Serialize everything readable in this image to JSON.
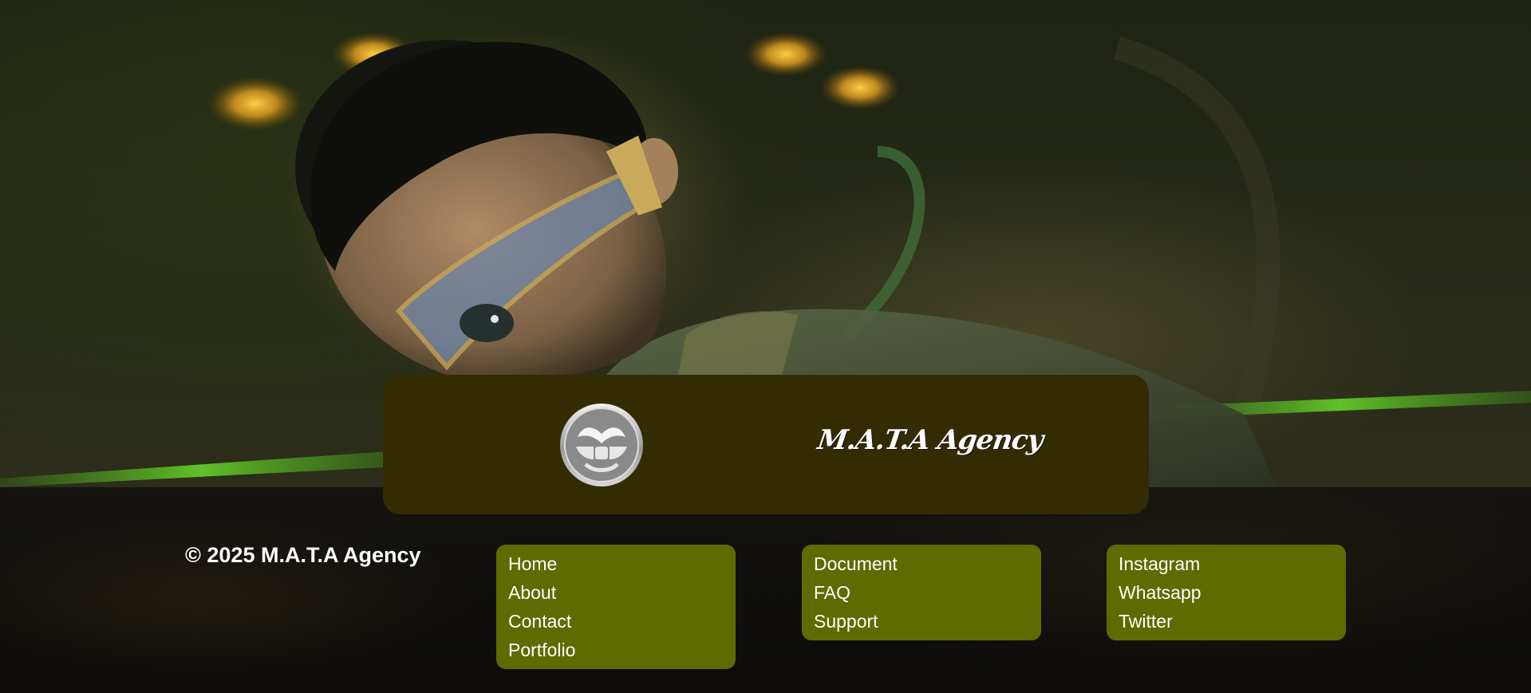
{
  "brand": {
    "name": "M.A.T.A Agency",
    "logo_icon": "mask-emblem-icon"
  },
  "footer": {
    "copyright": "© 2025 M.A.T.A Agency",
    "columns": [
      {
        "links": [
          "Home",
          "About",
          "Contact",
          "Portfolio"
        ]
      },
      {
        "links": [
          "Document",
          "FAQ",
          "Support"
        ]
      },
      {
        "links": [
          "Instagram",
          "Whatsapp",
          "Twitter"
        ]
      }
    ]
  },
  "colors": {
    "brand_card": "#332c03",
    "link_box": "#5e6b00",
    "text": "#ffffff"
  }
}
